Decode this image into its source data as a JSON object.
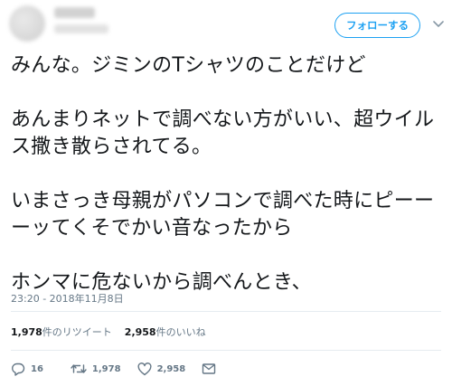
{
  "header": {
    "follow_label": "フォローする"
  },
  "tweet": {
    "paragraphs": [
      "みんな。ジミンのTシャツのことだけど",
      "あんまりネットで調べない方がいい、超ウイルス撒き散らされてる。",
      "いまさっき母親がパソコンで調べた時にピーーーッてくそでかい音なったから",
      "ホンマに危ないから調べんとき、"
    ],
    "timestamp": "23:20 - 2018年11月8日"
  },
  "stats": {
    "retweets_count": "1,978",
    "retweets_label": "件のリツイート",
    "likes_count": "2,958",
    "likes_label": "件のいいね"
  },
  "actions": {
    "reply_count": "16",
    "retweet_count": "1,978",
    "like_count": "2,958"
  },
  "colors": {
    "accent": "#1da1f2",
    "muted": "#657786",
    "text": "#14171a"
  },
  "icons": [
    "reply-icon",
    "retweet-icon",
    "heart-icon",
    "dm-icon",
    "chevron-down-icon"
  ]
}
